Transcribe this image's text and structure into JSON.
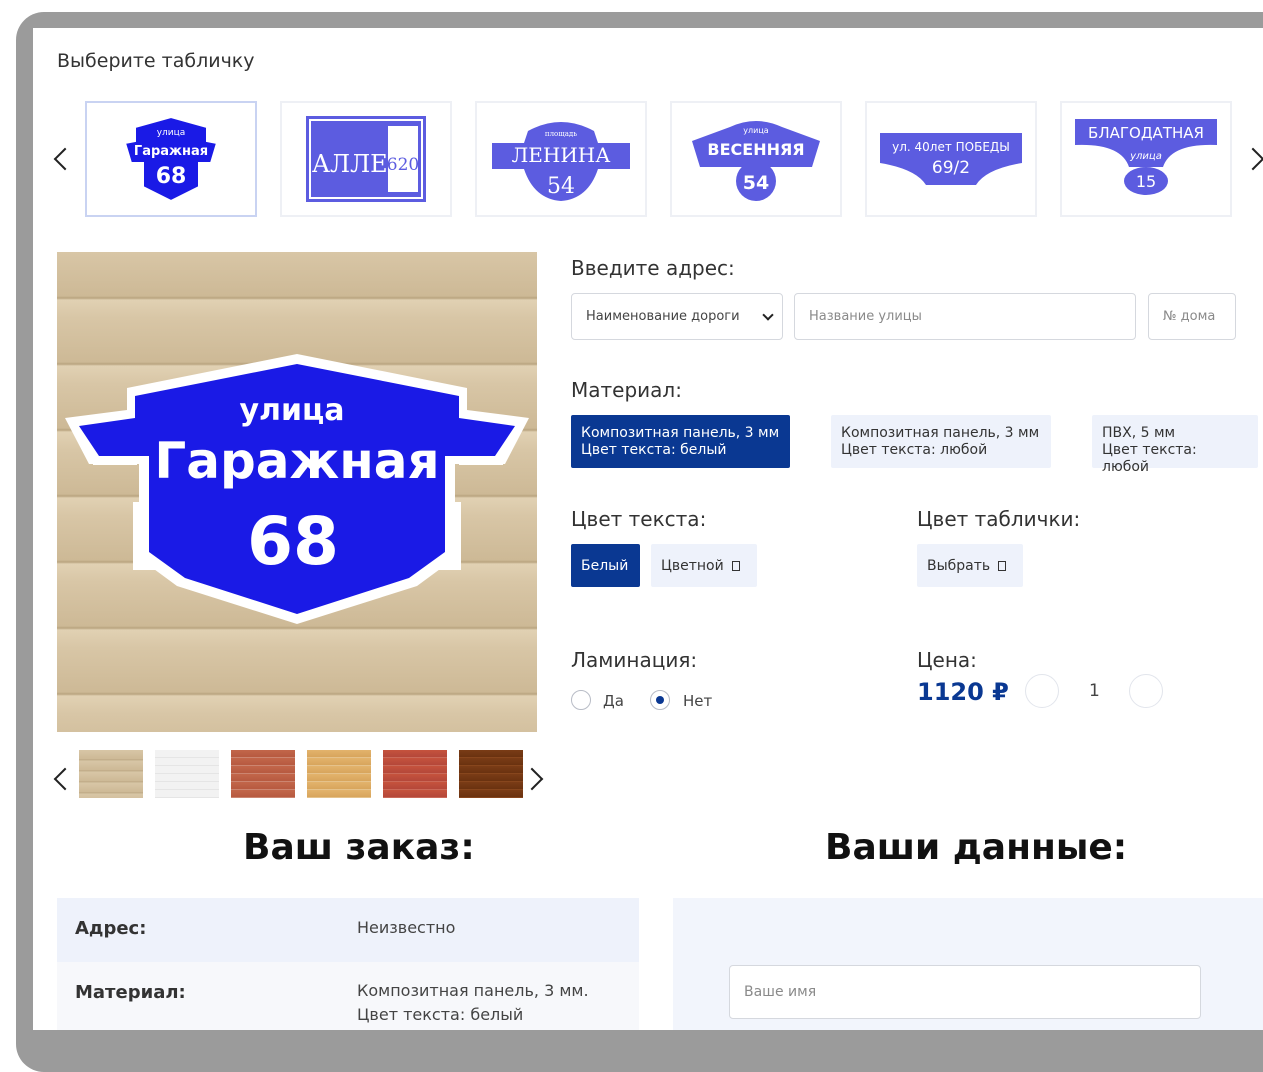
{
  "page": {
    "choose_title": "Выберите табличку"
  },
  "signs": [
    {
      "lines": [
        "улица",
        "Гаражная",
        "68"
      ]
    },
    {
      "lines": [
        "6 АЛЛЕЯ",
        "620"
      ]
    },
    {
      "lines": [
        "площадь",
        "ЛЕНИНА",
        "54"
      ]
    },
    {
      "lines": [
        "улица",
        "ВЕСЕННЯЯ",
        "54"
      ]
    },
    {
      "lines": [
        "ул. 40лет ПОБЕДЫ",
        "69/2"
      ]
    },
    {
      "lines": [
        "БЛАГОДАТНАЯ",
        "улица",
        "15"
      ]
    }
  ],
  "preview": {
    "line1": "улица",
    "line2": "Гаражная",
    "line3": "68"
  },
  "address": {
    "label": "Введите адрес:",
    "road_type": "Наименование дороги",
    "street_placeholder": "Название улицы",
    "house_placeholder": "№ дома"
  },
  "material": {
    "label": "Материал:",
    "options": [
      {
        "line1": "Композитная панель, 3 мм",
        "line2": "Цвет текста: белый",
        "active": true
      },
      {
        "line1": "Композитная панель, 3 мм",
        "line2": "Цвет текста: любой",
        "active": false
      },
      {
        "line1": "ПВХ, 5 мм",
        "line2": "Цвет текста: любой",
        "active": false
      }
    ]
  },
  "text_color": {
    "label": "Цвет текста:",
    "white": "Белый",
    "colored": "Цветной"
  },
  "sign_color": {
    "label": "Цвет таблички:",
    "choose": "Выбрать"
  },
  "lamination": {
    "label": "Ламинация:",
    "yes": "Да",
    "no": "Нет",
    "selected": "no"
  },
  "price": {
    "label": "Цена:",
    "value": "1120 ₽",
    "quantity": "1"
  },
  "backgrounds": [
    "siding-beige",
    "brick-white",
    "brick-red",
    "brick-yellow",
    "brick-dark-red",
    "wood-brown"
  ],
  "order": {
    "heading": "Ваш заказ:",
    "rows": [
      {
        "key": "Адрес:",
        "value": "Неизвестно"
      },
      {
        "key": "Материал:",
        "value_line1": "Композитная панель, 3 мм.",
        "value_line2": "Цвет текста: белый"
      }
    ]
  },
  "customer": {
    "heading": "Ваши данные:",
    "name_placeholder": "Ваше имя"
  },
  "colors": {
    "accent": "#0a3892",
    "sign_blue": "#1a1ae6",
    "pale": "#eef2fb"
  }
}
